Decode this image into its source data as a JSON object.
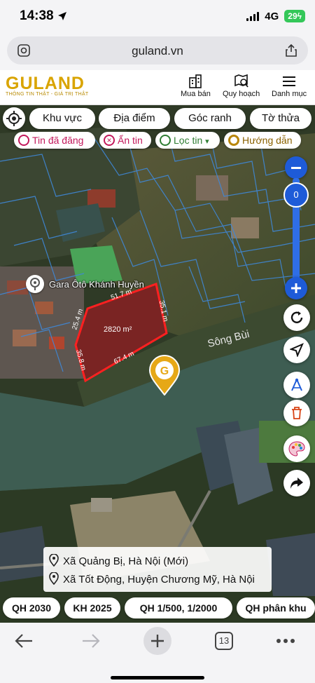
{
  "status": {
    "time": "14:38",
    "network": "4G",
    "battery": "29"
  },
  "browser": {
    "url": "guland.vn",
    "tab_count": "13"
  },
  "site": {
    "logo": "GULAND",
    "tagline": "THÔNG TIN THẬT - GIÁ TRỊ THẬT",
    "nav": [
      {
        "label": "Mua bán"
      },
      {
        "label": "Quy hoạch"
      },
      {
        "label": "Danh mục"
      }
    ]
  },
  "filters": {
    "row1": [
      "Khu vực",
      "Địa điểm",
      "Góc ranh",
      "Tờ thửa"
    ],
    "row2": [
      {
        "label": "Tin đã đăng",
        "color": "#c2185b"
      },
      {
        "label": "Ẩn tin",
        "color": "#c2185b"
      },
      {
        "label": "Lọc tin",
        "color": "#2e7d32"
      },
      {
        "label": "Hướng dẫn",
        "color": "#b8860b"
      }
    ]
  },
  "map": {
    "poi_label": "Gara Ôtô Khánh Huyền",
    "river_label": "Sông Bùi",
    "zoom_value": "0",
    "parcel": {
      "area": "2820 m²",
      "edge_top": "51.7 m",
      "edge_right": "35.1 m",
      "edge_bottom": "67.4 m",
      "edge_left_lower": "35.8 m",
      "edge_left_upper": "25.4 m"
    }
  },
  "address": {
    "line1": "Xã Quảng Bị, Hà Nội (Mới)",
    "line2": "Xã Tốt Động, Huyện Chương Mỹ, Hà Nội"
  },
  "plans": [
    "QH 2030",
    "KH 2025",
    "QH 1/500, 1/2000",
    "QH phân khu"
  ],
  "colors": {
    "brand": "#d9a400",
    "accent_blue": "#1e5bd8",
    "parcel_red": "#e0201c"
  }
}
